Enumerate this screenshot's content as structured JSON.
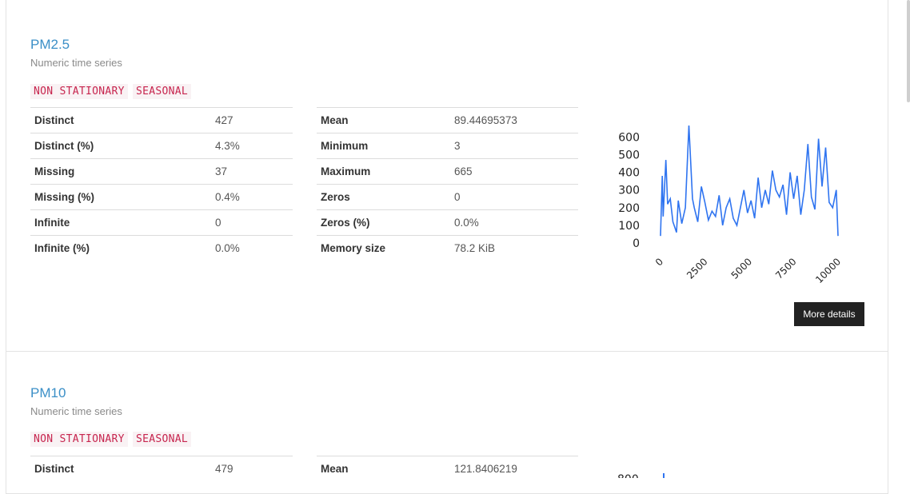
{
  "variables": [
    {
      "name": "PM2.5",
      "type_label": "Numeric time series",
      "badges": [
        "NON STATIONARY",
        "SEASONAL"
      ],
      "left_table": [
        {
          "key": "Distinct",
          "value": "427"
        },
        {
          "key": "Distinct (%)",
          "value": "4.3%"
        },
        {
          "key": "Missing",
          "value": "37"
        },
        {
          "key": "Missing (%)",
          "value": "0.4%"
        },
        {
          "key": "Infinite",
          "value": "0"
        },
        {
          "key": "Infinite (%)",
          "value": "0.0%"
        }
      ],
      "right_table": [
        {
          "key": "Mean",
          "value": "89.44695373"
        },
        {
          "key": "Minimum",
          "value": "3"
        },
        {
          "key": "Maximum",
          "value": "665"
        },
        {
          "key": "Zeros",
          "value": "0"
        },
        {
          "key": "Zeros (%)",
          "value": "0.0%"
        },
        {
          "key": "Memory size",
          "value": "78.2 KiB"
        }
      ],
      "more_details_label": "More details"
    },
    {
      "name": "PM10",
      "type_label": "Numeric time series",
      "badges": [
        "NON STATIONARY",
        "SEASONAL"
      ],
      "left_table": [
        {
          "key": "Distinct",
          "value": "479"
        }
      ],
      "right_table": [
        {
          "key": "Mean",
          "value": "121.8406219"
        }
      ]
    }
  ],
  "chart_data": {
    "type": "line",
    "title": "",
    "xlabel": "",
    "ylabel": "",
    "xlim": [
      0,
      10000
    ],
    "ylim": [
      0,
      665
    ],
    "x_ticks": [
      "0",
      "2500",
      "5000",
      "7500",
      "10000"
    ],
    "y_ticks": [
      "0",
      "100",
      "200",
      "300",
      "400",
      "500",
      "600"
    ],
    "series_color": "#2f74f0",
    "series": [
      {
        "x": [
          0,
          100,
          150,
          300,
          400,
          550,
          700,
          800,
          900,
          1000,
          1200,
          1400,
          1600,
          1800,
          1900,
          2100,
          2300,
          2500,
          2700,
          2900,
          3100,
          3300,
          3500,
          3700,
          3900,
          4100,
          4300,
          4500,
          4700,
          4900,
          5100,
          5300,
          5500,
          5700,
          5900,
          6100,
          6300,
          6500,
          6700,
          6900,
          7100,
          7300,
          7500,
          7700,
          7900,
          8100,
          8300,
          8500,
          8700,
          8900,
          9100,
          9300,
          9500,
          9700,
          9900,
          10000
        ],
        "values": [
          40,
          380,
          150,
          470,
          220,
          250,
          120,
          90,
          60,
          240,
          110,
          200,
          665,
          250,
          200,
          120,
          320,
          230,
          130,
          180,
          150,
          270,
          100,
          200,
          250,
          140,
          100,
          200,
          300,
          170,
          240,
          140,
          370,
          200,
          300,
          220,
          410,
          300,
          260,
          330,
          160,
          400,
          250,
          380,
          160,
          300,
          560,
          260,
          190,
          590,
          320,
          540,
          230,
          200,
          300,
          40
        ]
      }
    ]
  }
}
